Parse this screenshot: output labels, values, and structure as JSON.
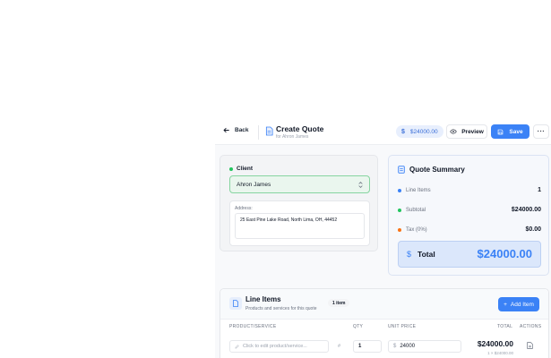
{
  "header": {
    "back_label": "Back",
    "title": "Create Quote",
    "subtitle": "for Ahron James",
    "price_badge": "$24000.00",
    "price_badge_icon": "$",
    "preview_label": "Preview",
    "save_label": "Save",
    "more_label": "···"
  },
  "client": {
    "label": "Client",
    "selected": "Ahron James",
    "address_label": "Address:",
    "address_value": "25 East Pine Lake Road, North Lima, OH, 44452"
  },
  "summary": {
    "title": "Quote Summary",
    "rows": [
      {
        "label": "Line Items",
        "value": "1",
        "dot_color": "#3b82f6"
      },
      {
        "label": "Subtotal",
        "value": "$24000.00",
        "dot_color": "#22c55e"
      },
      {
        "label": "Tax (0%)",
        "value": "$0.00",
        "dot_color": "#f97316"
      }
    ],
    "total_icon": "$",
    "total_label": "Total",
    "total_value": "$24000.00"
  },
  "line_items": {
    "title": "Line Items",
    "subtitle": "Products and services for this quote",
    "badge": "1 item",
    "add_label": "Add Item",
    "add_icon": "+",
    "columns": [
      "PRODUCT/SERVICE",
      "QTY",
      "UNIT PRICE",
      "TOTAL",
      "ACTIONS"
    ],
    "rows": [
      {
        "product_placeholder": "Click to edit product/service...",
        "hash": "#",
        "qty": "1",
        "currency": "$",
        "unit_price": "24000",
        "total": "$24000.00",
        "total_sub": "1 × $24000.00"
      }
    ]
  },
  "colors": {
    "accent": "#3b82f6",
    "success": "#22c55e",
    "warning": "#f97316"
  }
}
